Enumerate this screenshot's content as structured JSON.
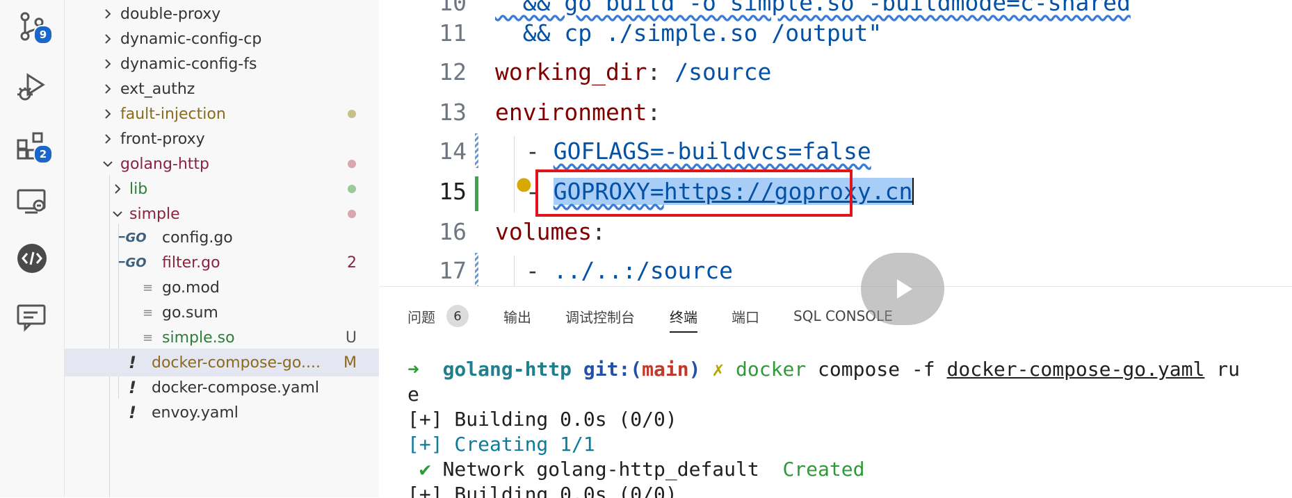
{
  "activity_bar": {
    "source_control_badge": "9",
    "extensions_badge": "2"
  },
  "explorer": {
    "items": [
      {
        "label": "double-proxy",
        "kind": "folder",
        "expanded": false,
        "status": ""
      },
      {
        "label": "dynamic-config-cp",
        "kind": "folder",
        "expanded": false,
        "status": ""
      },
      {
        "label": "dynamic-config-fs",
        "kind": "folder",
        "expanded": false,
        "status": ""
      },
      {
        "label": "ext_authz",
        "kind": "folder",
        "expanded": false,
        "status": ""
      },
      {
        "label": "fault-injection",
        "kind": "folder",
        "expanded": false,
        "status": ""
      },
      {
        "label": "front-proxy",
        "kind": "folder",
        "expanded": false,
        "status": ""
      },
      {
        "label": "golang-http",
        "kind": "folder",
        "expanded": true,
        "status": ""
      },
      {
        "label": "lib",
        "kind": "folder",
        "expanded": false,
        "status": ""
      },
      {
        "label": "simple",
        "kind": "folder",
        "expanded": true,
        "status": ""
      },
      {
        "label": "config.go",
        "kind": "go",
        "status": ""
      },
      {
        "label": "filter.go",
        "kind": "go",
        "status": "2"
      },
      {
        "label": "go.mod",
        "kind": "text",
        "status": ""
      },
      {
        "label": "go.sum",
        "kind": "text",
        "status": ""
      },
      {
        "label": "simple.so",
        "kind": "text",
        "status": "U"
      },
      {
        "label": "docker-compose-go....",
        "kind": "yaml",
        "status": "M"
      },
      {
        "label": "docker-compose.yaml",
        "kind": "yaml",
        "status": ""
      },
      {
        "label": "envoy.yaml",
        "kind": "yaml",
        "status": ""
      }
    ],
    "go_icon_text": "GO",
    "yaml_icon_text": "!"
  },
  "editor": {
    "lines": [
      {
        "num": "10",
        "text": "  && go build -o simple.so -buildmode=c-shared"
      },
      {
        "num": "11",
        "text": "  && cp ./simple.so /output\""
      },
      {
        "num": "12",
        "key": "working_dir",
        "sep": ":",
        "value": " /source"
      },
      {
        "num": "13",
        "key": "environment",
        "sep": ":",
        "value": ""
      },
      {
        "num": "14",
        "dash": "- ",
        "value": "GOFLAGS=-buildvcs=false"
      },
      {
        "num": "15",
        "dash": "- ",
        "value_a": "GOPROXY=",
        "value_b": "https://goproxy.cn"
      },
      {
        "num": "16",
        "key": "volumes",
        "sep": ":",
        "value": ""
      },
      {
        "num": "17",
        "dash": "- ",
        "value": "../..:/source"
      }
    ]
  },
  "panel": {
    "tabs": [
      {
        "label": "问题",
        "count": "6"
      },
      {
        "label": "输出"
      },
      {
        "label": "调试控制台"
      },
      {
        "label": "终端",
        "active": true
      },
      {
        "label": "端口"
      },
      {
        "label": "SQL CONSOLE"
      }
    ],
    "terminal": {
      "prompt_arrow": "➜",
      "dir": "golang-http",
      "git_prefix": "git:(",
      "branch": "main",
      "git_suffix": ")",
      "dirty": "✗",
      "command": "docker",
      "args_a": " compose -f ",
      "file": "docker-compose-go.yaml",
      "args_b": " ru",
      "wrap": "e",
      "build1": "[+] Building 0.0s (0/0)",
      "creating": "[+] Creating 1/1",
      "check": " ✔",
      "network": " Network golang-http_default  ",
      "created": "Created",
      "build2": "[+] Building 0.0s (0/0)"
    }
  }
}
